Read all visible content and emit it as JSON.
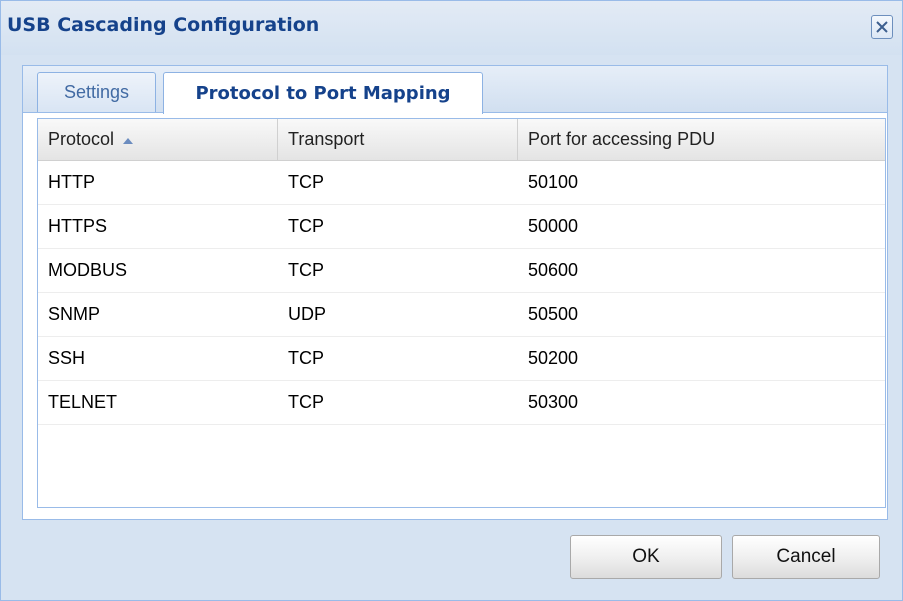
{
  "dialog": {
    "title": "USB Cascading Configuration",
    "close_icon": "close-icon"
  },
  "tabs": [
    {
      "label": "Settings",
      "active": false
    },
    {
      "label": "Protocol to Port Mapping",
      "active": true
    }
  ],
  "grid": {
    "columns": [
      {
        "label": "Protocol",
        "sorted": "ascending",
        "sort_icon": "sort-ascending-icon"
      },
      {
        "label": "Transport"
      },
      {
        "label": "Port for accessing PDU"
      }
    ],
    "rows": [
      [
        "HTTP",
        "TCP",
        "50100"
      ],
      [
        "HTTPS",
        "TCP",
        "50000"
      ],
      [
        "MODBUS",
        "TCP",
        "50600"
      ],
      [
        "SNMP",
        "UDP",
        "50500"
      ],
      [
        "SSH",
        "TCP",
        "50200"
      ],
      [
        "TELNET",
        "TCP",
        "50300"
      ]
    ]
  },
  "buttons": {
    "ok_label": "OK",
    "cancel_label": "Cancel"
  },
  "colors": {
    "title_text": "#15428b",
    "dialog_background": "#d6e3f2",
    "border": "#99bbe8"
  }
}
